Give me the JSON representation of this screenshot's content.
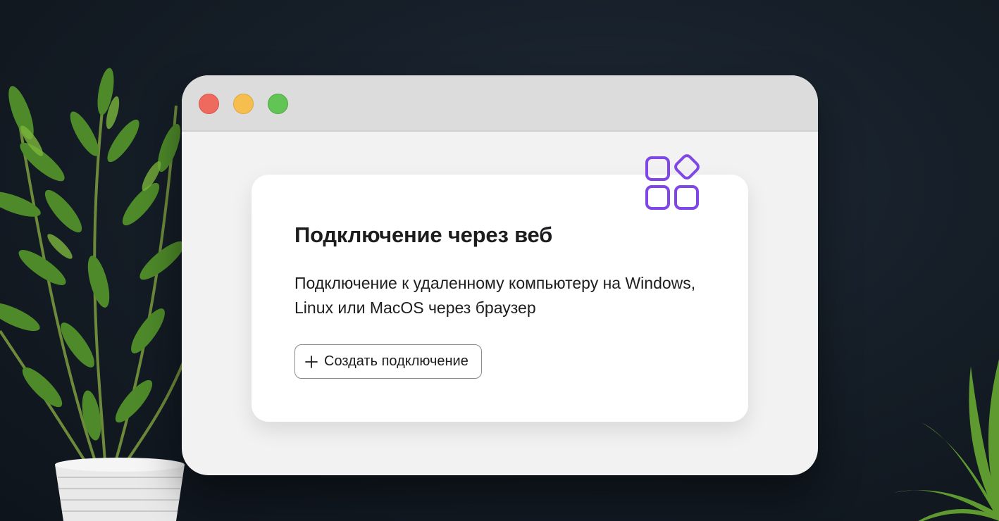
{
  "window": {
    "controls": [
      "close",
      "minimize",
      "maximize"
    ]
  },
  "card": {
    "icon": "apps-grid-icon",
    "title": "Подключение через веб",
    "description": "Подключение к удаленному компьютеру на Windows,\nLinux или  MacOS через браузер",
    "button": {
      "icon": "plus-icon",
      "label": "Создать подключение"
    }
  },
  "colors": {
    "accent": "#8046e8",
    "close": "#ee6a5f",
    "minimize": "#f6be4f",
    "maximize": "#61c454",
    "background": "#141c25"
  }
}
